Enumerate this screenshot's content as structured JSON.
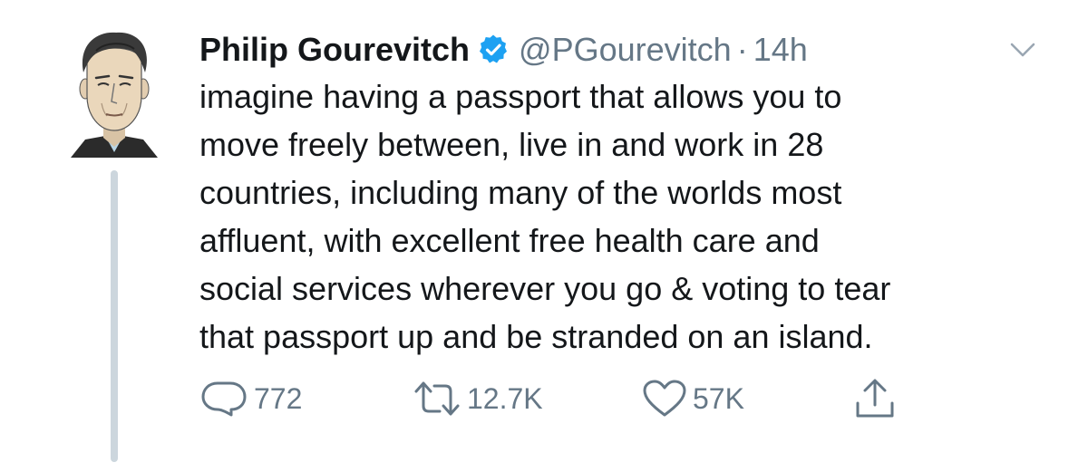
{
  "tweet": {
    "display_name": "Philip Gourevitch",
    "handle": "@PGourevitch",
    "separator": "·",
    "time": "14h",
    "text_lines": [
      "imagine having a passport that allows you to",
      "move freely between, live in and work in 28",
      "countries, including many of the worlds most",
      "affluent, with excellent free health care and",
      "social services wherever you go & voting to tear",
      "that passport up and be stranded on an island."
    ],
    "actions": {
      "replies": "772",
      "retweets": "12.7K",
      "likes": "57K"
    }
  },
  "icons": {
    "verified": "verified-badge-icon",
    "caret": "chevron-down-icon",
    "reply": "reply-icon",
    "retweet": "retweet-icon",
    "like": "heart-icon",
    "share": "share-icon"
  },
  "colors": {
    "text": "#14171a",
    "secondary": "#657786",
    "verified": "#1da1f2",
    "thread_line": "#ccd6dd"
  }
}
